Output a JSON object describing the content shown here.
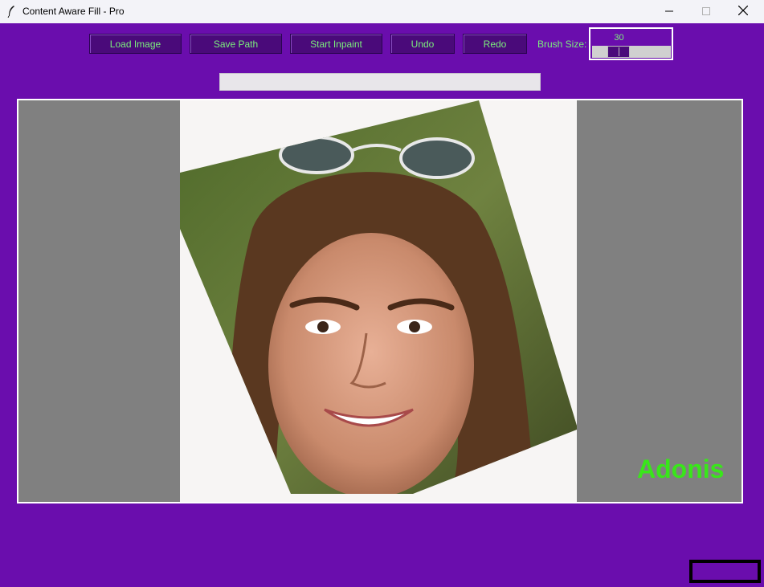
{
  "window": {
    "title": "Content Aware Fill - Pro",
    "icon": "feather-icon",
    "controls": {
      "minimize": "minimize-icon",
      "maximize": "maximize-icon",
      "close": "close-icon"
    }
  },
  "toolbar": {
    "load_label": "Load Image",
    "save_label": "Save Path",
    "inpaint_label": "Start Inpaint",
    "undo_label": "Undo",
    "redo_label": "Redo",
    "brush_label": "Brush Size:",
    "brush_value": "30"
  },
  "canvas": {
    "watermark": "Adonis",
    "image_description_icon": "portrait-photo"
  },
  "colors": {
    "background": "#6a0dad",
    "button": "#4a0a7a",
    "button_text": "#7cf07c",
    "watermark": "#39e61a",
    "canvas": "#808080"
  }
}
